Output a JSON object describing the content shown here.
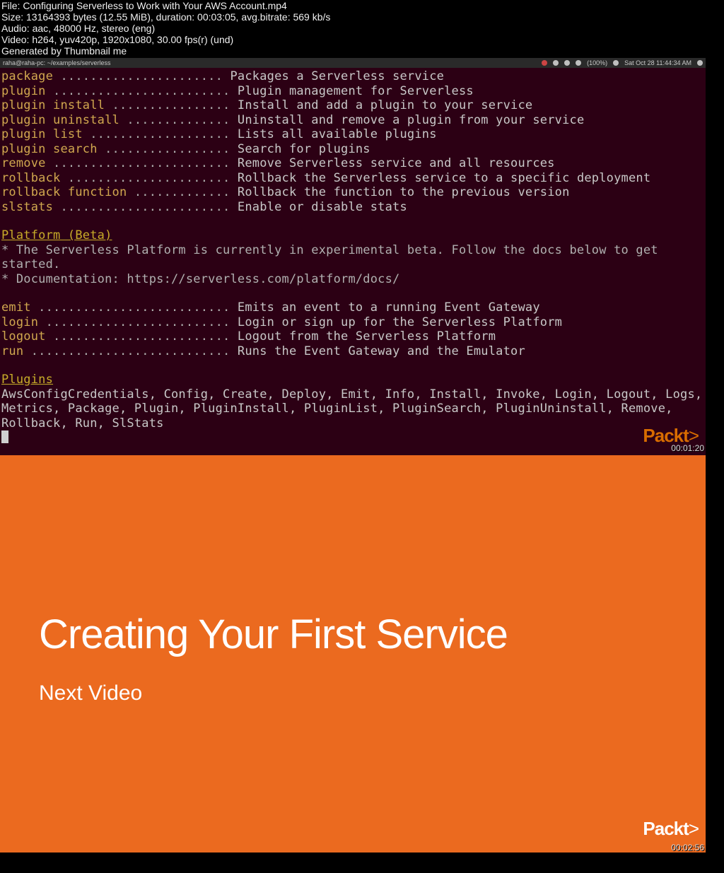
{
  "fileinfo": {
    "file": "File: Configuring Serverless to Work with Your AWS Account.mp4",
    "size": "Size: 13164393 bytes (12.55 MiB), duration: 00:03:05, avg.bitrate: 569 kb/s",
    "audio": "Audio: aac, 48000 Hz, stereo (eng)",
    "video": "Video: h264, yuv420p, 1920x1080, 30.00 fps(r) (und)",
    "gen": "Generated by Thumbnail me"
  },
  "menubar": {
    "prompt": "raha@raha-pc: ~/examples/serverless",
    "battery": "(100%)",
    "clock": "Sat Oct 28 11:44:34 AM"
  },
  "cli": {
    "commands": [
      {
        "cmd": "package",
        "dots": " ......................",
        "desc": " Packages a Serverless service"
      },
      {
        "cmd": "plugin",
        "dots": " ........................",
        "desc": " Plugin management for Serverless"
      },
      {
        "cmd": "plugin install",
        "dots": " ................",
        "desc": " Install and add a plugin to your service"
      },
      {
        "cmd": "plugin uninstall",
        "dots": " ..............",
        "desc": " Uninstall and remove a plugin from your service"
      },
      {
        "cmd": "plugin list",
        "dots": " ...................",
        "desc": " Lists all available plugins"
      },
      {
        "cmd": "plugin search",
        "dots": " .................",
        "desc": " Search for plugins"
      },
      {
        "cmd": "remove",
        "dots": " ........................",
        "desc": " Remove Serverless service and all resources"
      },
      {
        "cmd": "rollback",
        "dots": " ......................",
        "desc": " Rollback the Serverless service to a specific deployment"
      },
      {
        "cmd": "rollback function",
        "dots": " .............",
        "desc": " Rollback the function to the previous version"
      },
      {
        "cmd": "slstats",
        "dots": " .......................",
        "desc": " Enable or disable stats"
      }
    ],
    "platform_title": "Platform (Beta)",
    "platform_body1": "* The Serverless Platform is currently in experimental beta. Follow the docs below to get started.",
    "platform_body2": "* Documentation: https://serverless.com/platform/docs/",
    "platform_cmds": [
      {
        "cmd": "emit",
        "dots": " ..........................",
        "desc": " Emits an event to a running Event Gateway"
      },
      {
        "cmd": "login",
        "dots": " .........................",
        "desc": " Login or sign up for the Serverless Platform"
      },
      {
        "cmd": "logout",
        "dots": " ........................",
        "desc": " Logout from the Serverless Platform"
      },
      {
        "cmd": "run",
        "dots": " ...........................",
        "desc": " Runs the Event Gateway and the Emulator"
      }
    ],
    "plugins_title": "Plugins",
    "plugins_body": "AwsConfigCredentials, Config, Create, Deploy, Emit, Info, Install, Invoke, Login, Logout, Logs, Metrics, Package, Plugin, PluginInstall, PluginList, PluginSearch, PluginUninstall, Remove, Rollback, Run, SlStats"
  },
  "logo": {
    "text": "Packt",
    "gt": ">"
  },
  "timestamps": {
    "frame1": "00:01:20",
    "frame2": "00:02:56"
  },
  "slide": {
    "title": "Creating Your First Service",
    "subtitle": "Next Video"
  }
}
